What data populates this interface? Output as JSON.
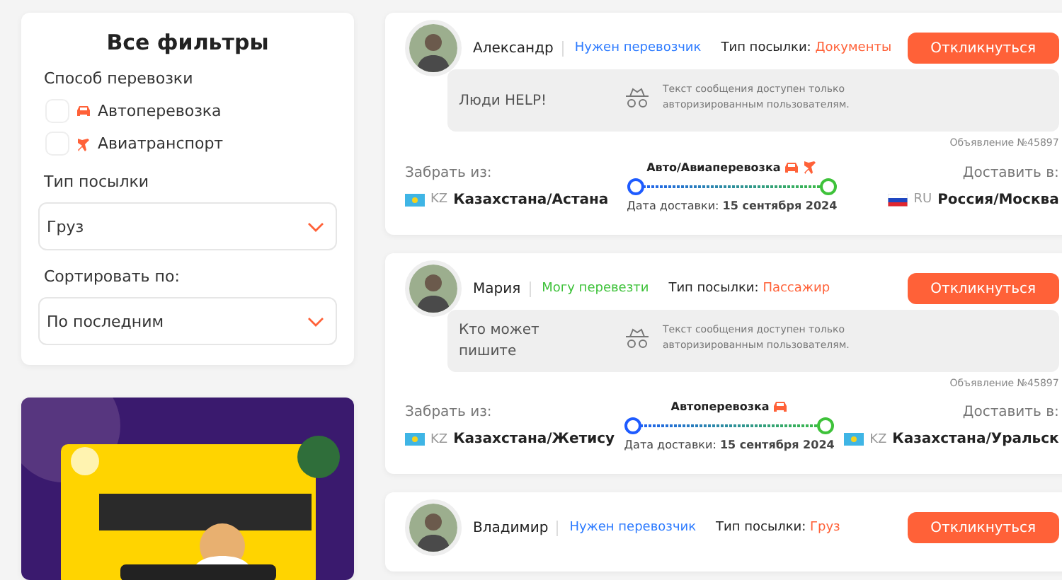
{
  "filters": {
    "title": "Все фильтры",
    "transport_label": "Способ перевозки",
    "transport_options": [
      {
        "kind": "car",
        "label": "Автоперевозка",
        "checked": false
      },
      {
        "kind": "plane",
        "label": "Авиатранспорт",
        "checked": false
      }
    ],
    "parcel_label": "Тип посылки",
    "parcel_value": "Груз",
    "sort_label": "Сортировать по:",
    "sort_value": "По последним"
  },
  "listings": [
    {
      "name": "Александр",
      "role": {
        "label": "Нужен перевозчик",
        "color": "#2d7bff"
      },
      "type_label": "Тип посылки:",
      "type_value": "Документы",
      "button": "Откликнуться",
      "message_lines": [
        "Люди HELP!"
      ],
      "locked_note": "Текст сообщения доступен только авторизированным пользователям.",
      "ad_number": "Объявление №45897",
      "from_label": "Забрать из:",
      "from": {
        "kind": "kz",
        "code": "KZ",
        "city": "Казахстана/Астана"
      },
      "transport": "Авто/Авиаперевозка",
      "transport_icons": [
        {
          "kind": "car"
        },
        {
          "kind": "plane"
        }
      ],
      "date_label": "Дата доставки:",
      "date": "15 сентября 2024",
      "to_label": "Доставить в:",
      "to": {
        "kind": "ru",
        "code": "RU",
        "city": "Россия/Москва"
      }
    },
    {
      "name": "Мария",
      "role": {
        "label": "Могу перевезти",
        "color": "#3ec23a"
      },
      "type_label": "Тип посылки:",
      "type_value": "Пассажир",
      "button": "Откликнуться",
      "message_lines": [
        "Кто может",
        "пишите"
      ],
      "locked_note": "Текст сообщения доступен только авторизированным пользователям.",
      "ad_number": "Объявление №45897",
      "from_label": "Забрать из:",
      "from": {
        "kind": "kz",
        "code": "KZ",
        "city": "Казахстана/Жетису"
      },
      "transport": "Автоперевозка",
      "transport_icons": [
        {
          "kind": "car"
        }
      ],
      "date_label": "Дата доставки:",
      "date": "15 сентября 2024",
      "to_label": "Доставить в:",
      "to": {
        "kind": "kz",
        "code": "KZ",
        "city": "Казахстана/Уральск"
      }
    },
    {
      "name": "Владимир",
      "role": {
        "label": "Нужен перевозчик",
        "color": "#2d7bff"
      },
      "type_label": "Тип посылки:",
      "type_value": "Груз",
      "button": "Откликнуться"
    }
  ]
}
